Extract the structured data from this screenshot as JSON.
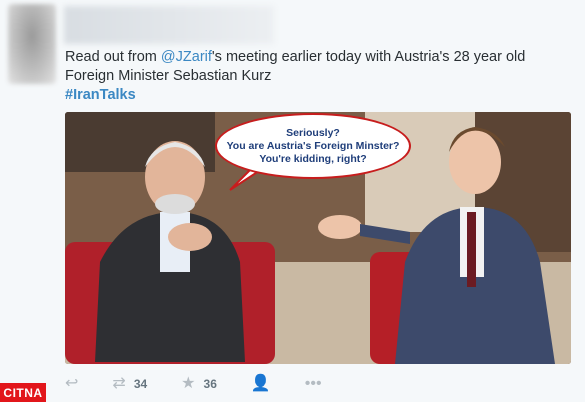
{
  "tweet": {
    "text_prefix": "Read out from ",
    "mention": "@JZarif",
    "text_suffix": "'s meeting earlier today with Austria's 28 year old Foreign Minister Sebastian Kurz",
    "hashtag": "#IranTalks"
  },
  "image": {
    "speech_bubble": [
      "Seriously?",
      "You are Austria's Foreign Minster?",
      "You're kidding, right?"
    ]
  },
  "actions": {
    "reply_icon": "reply-icon",
    "retweet_icon": "retweet-icon",
    "retweet_count": "34",
    "favorite_icon": "star-icon",
    "favorite_count": "36",
    "follow_icon": "follow-icon",
    "more_icon": "more-icon"
  },
  "watermark": "CITNA",
  "colors": {
    "link": "#3b88c3",
    "bubble_border": "#c71d1d",
    "watermark_bg": "#e2161b"
  }
}
